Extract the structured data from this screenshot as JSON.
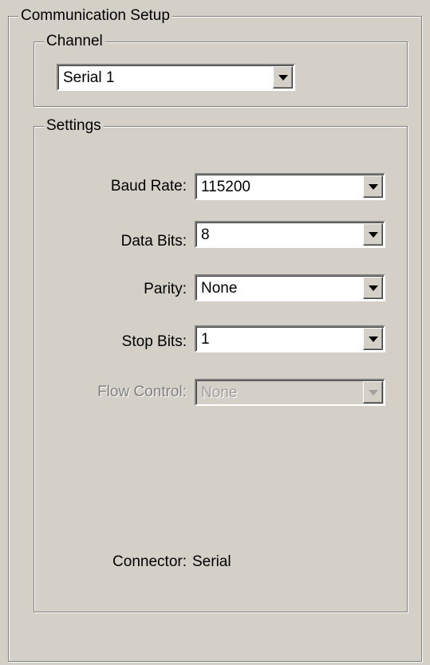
{
  "communication_setup": {
    "title": "Communication Setup",
    "channel": {
      "title": "Channel",
      "selected": "Serial 1",
      "dropdown_icon": "chevron-down-icon"
    },
    "settings": {
      "title": "Settings",
      "fields": [
        {
          "label": "Baud Rate:",
          "value": "115200",
          "enabled": true
        },
        {
          "label": "Data Bits:",
          "value": "8",
          "enabled": true
        },
        {
          "label": "Parity:",
          "value": "None",
          "enabled": true
        },
        {
          "label": "Stop Bits:",
          "value": "1",
          "enabled": true
        },
        {
          "label": "Flow Control:",
          "value": "None",
          "enabled": false
        }
      ],
      "connector_label": "Connector:",
      "connector_value": "Serial"
    }
  },
  "colors": {
    "face": "#d4d0c8",
    "field": "#ffffff",
    "shadow": "#808080",
    "disabled_text": "#a0a0a0"
  }
}
